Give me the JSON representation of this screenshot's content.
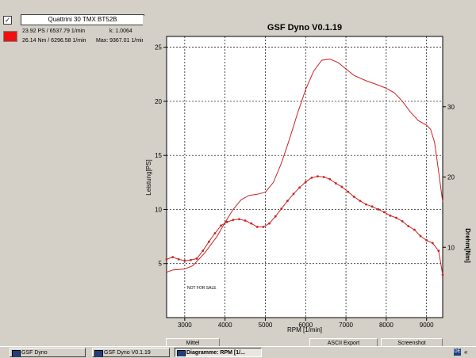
{
  "legend": {
    "checked_glyph": "✓",
    "vehicle_name": "Quattrini 30 TMX BT52B",
    "power_max": "23.92 PS / 6537.79 1/min",
    "k_factor": "k: 1.0064",
    "torque_max": "26.14 Nm / 6296.58 1/min",
    "rpm_max": "Max: 9367.01 1/min",
    "color": "#ee1111"
  },
  "chart_data": {
    "type": "line",
    "title": "GSF Dyno V0.1.19",
    "xlabel": "RPM [1/min]",
    "ylabel": "Leistung[PS]",
    "y2label": "Drehm[Nm]",
    "watermark": "NOT FOR SALE",
    "xlim": [
      2550,
      9400
    ],
    "ylim": [
      0,
      26
    ],
    "y2lim": [
      0,
      40
    ],
    "grid": true,
    "x_ticks": [
      3000,
      4000,
      5000,
      6000,
      7000,
      8000,
      9000
    ],
    "y_ticks": [
      5,
      10,
      15,
      20,
      25
    ],
    "y2_ticks": [
      10,
      20,
      30
    ],
    "series": [
      {
        "name": "Leistung",
        "axis": "left",
        "color": "#cc2222",
        "markers": false,
        "x": [
          2550,
          2700,
          3000,
          3200,
          3500,
          3800,
          4000,
          4200,
          4400,
          4600,
          4800,
          5000,
          5200,
          5400,
          5600,
          5800,
          6000,
          6200,
          6400,
          6600,
          6800,
          7000,
          7200,
          7500,
          7800,
          8000,
          8200,
          8400,
          8600,
          8800,
          9000,
          9100,
          9200,
          9300,
          9400
        ],
        "y": [
          4.2,
          4.4,
          4.5,
          4.8,
          6.0,
          7.5,
          8.8,
          10.0,
          10.9,
          11.3,
          11.4,
          11.6,
          12.5,
          14.3,
          16.5,
          18.9,
          21.1,
          22.8,
          23.8,
          23.9,
          23.6,
          23.0,
          22.4,
          21.9,
          21.5,
          21.2,
          20.8,
          20.0,
          19.0,
          18.2,
          17.8,
          17.4,
          16.2,
          13.5,
          10.7
        ]
      },
      {
        "name": "Drehmoment",
        "axis": "right",
        "color": "#cc2222",
        "markers": true,
        "x": [
          2550,
          2700,
          2850,
          3000,
          3150,
          3300,
          3450,
          3600,
          3750,
          3900,
          4050,
          4200,
          4350,
          4500,
          4650,
          4800,
          4950,
          5100,
          5250,
          5400,
          5550,
          5700,
          5850,
          6000,
          6150,
          6300,
          6450,
          6600,
          6750,
          6900,
          7050,
          7200,
          7350,
          7500,
          7650,
          7800,
          7950,
          8100,
          8250,
          8400,
          8550,
          8700,
          8850,
          9000,
          9150,
          9300,
          9400
        ],
        "y": [
          8.3,
          8.6,
          8.3,
          8.1,
          8.2,
          8.4,
          9.5,
          10.8,
          12.0,
          13.1,
          13.6,
          13.9,
          14.0,
          13.8,
          13.4,
          12.9,
          12.9,
          13.4,
          14.4,
          15.5,
          16.6,
          17.6,
          18.5,
          19.3,
          19.9,
          20.1,
          20.0,
          19.7,
          19.1,
          18.6,
          17.9,
          17.2,
          16.6,
          16.1,
          15.8,
          15.4,
          15.0,
          14.5,
          14.2,
          13.7,
          13.0,
          12.5,
          11.6,
          11.0,
          10.6,
          9.5,
          6.1
        ]
      }
    ]
  },
  "buttons": {
    "mittel": "Mittel",
    "ascii_export": "ASCII Export",
    "screenshot": "Screenshot"
  },
  "taskbar": {
    "items": [
      {
        "label": "GSF Dyno",
        "active": false
      },
      {
        "label": "GSF Dyno V0.1.19",
        "active": false
      },
      {
        "label": "Diagramme: RPM [1/...",
        "active": true
      }
    ],
    "tray_icon_text": "DE",
    "tray_chevron": "«"
  }
}
